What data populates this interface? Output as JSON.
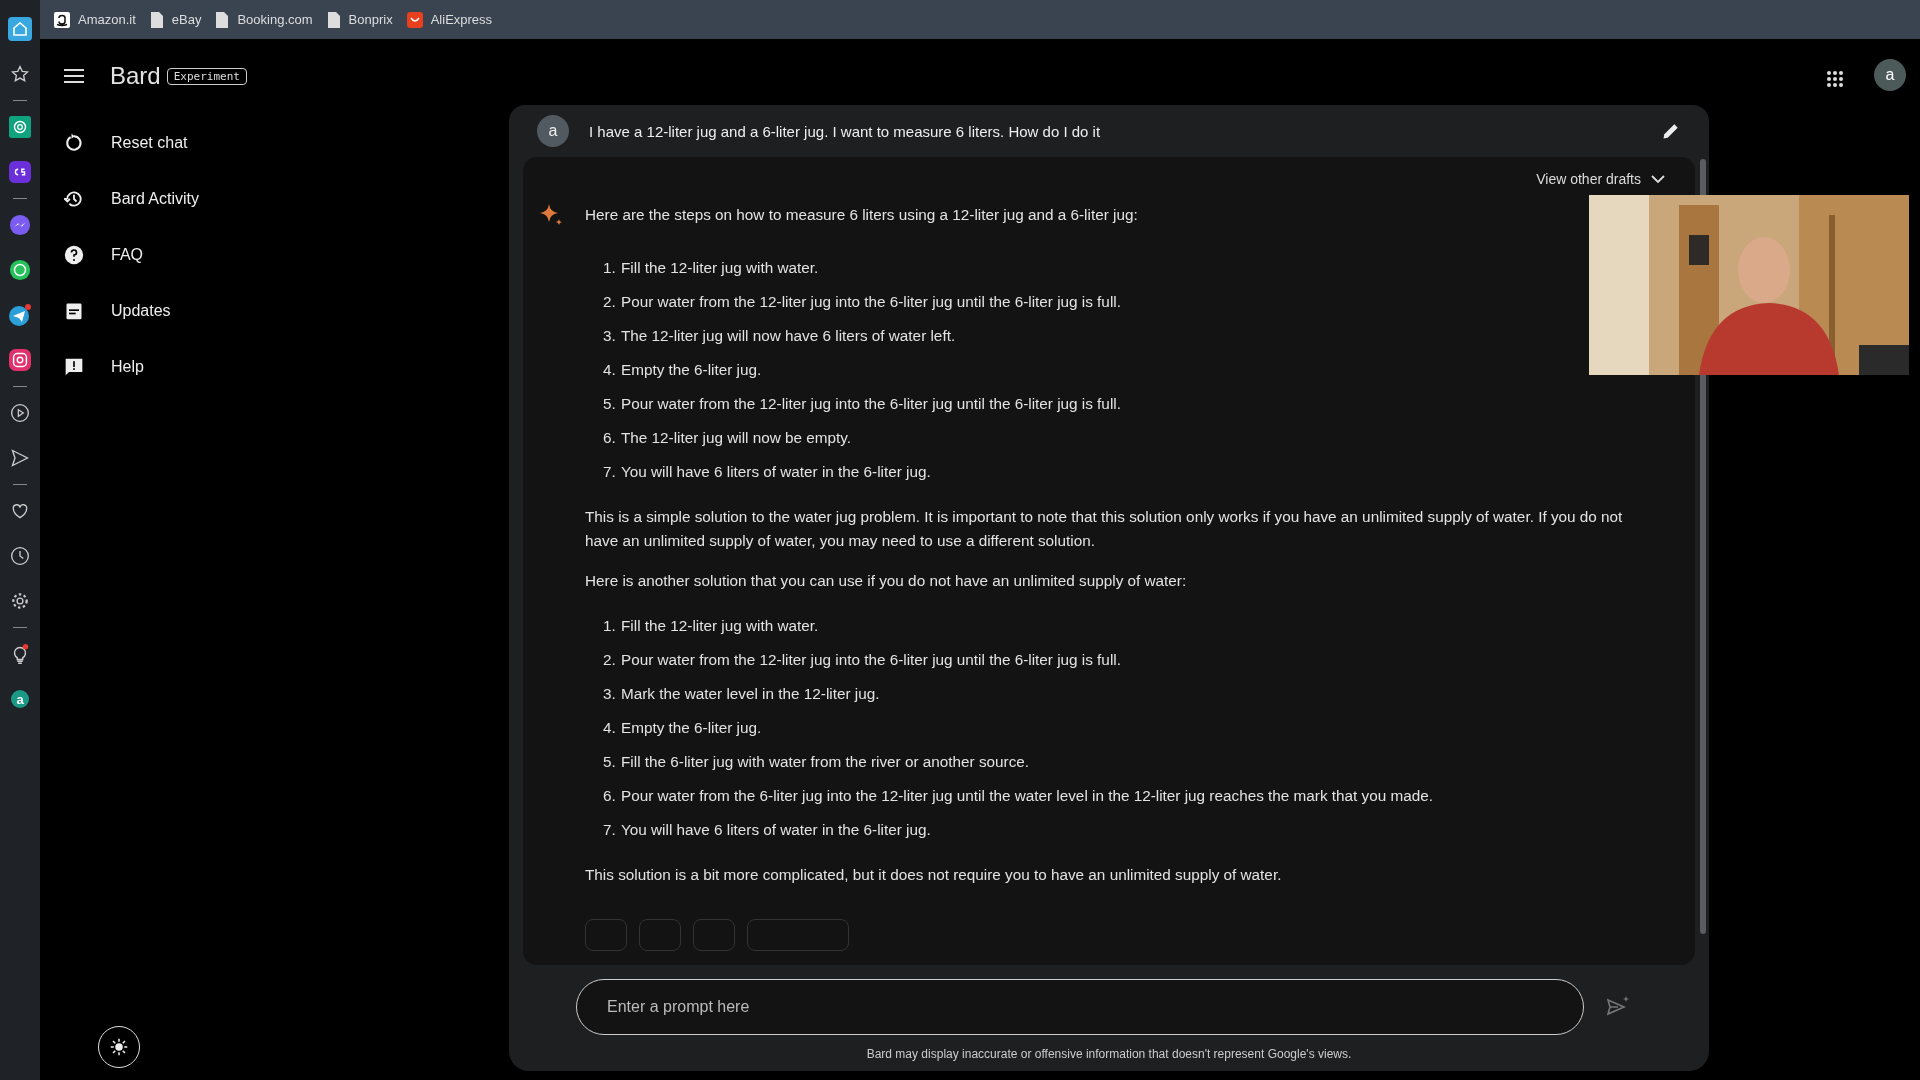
{
  "bookmarks": [
    {
      "label": "Amazon.it",
      "kind": "amazon"
    },
    {
      "label": "eBay",
      "kind": "page"
    },
    {
      "label": "Booking.com",
      "kind": "page"
    },
    {
      "label": "Bonprix",
      "kind": "page"
    },
    {
      "label": "AliExpress",
      "kind": "ali"
    }
  ],
  "header": {
    "title": "Bard",
    "badge": "Experiment",
    "avatar": "a"
  },
  "sidebar": {
    "items": [
      {
        "label": "Reset chat",
        "kind": "reset"
      },
      {
        "label": "Bard Activity",
        "kind": "history"
      },
      {
        "label": "FAQ",
        "kind": "faq"
      },
      {
        "label": "Updates",
        "kind": "updates"
      },
      {
        "label": "Help",
        "kind": "help"
      }
    ]
  },
  "dock": {
    "user_badge": "a"
  },
  "chat": {
    "prompt": {
      "avatar": "a",
      "text": "I have a 12-liter jug and a 6-liter jug. I want to measure 6 liters. How do I do it"
    },
    "drafts_label": "View other drafts",
    "response": [
      {
        "kind": "paragraph",
        "text": "Here are the steps on how to measure 6 liters using a 12-liter jug and a 6-liter jug:"
      },
      {
        "kind": "list",
        "items": [
          {
            "number": "1.",
            "text": "Fill the 12-liter jug with water."
          },
          {
            "number": "2.",
            "text": "Pour water from the 12-liter jug into the 6-liter jug until the 6-liter jug is full."
          },
          {
            "number": "3.",
            "text": "The 12-liter jug will now have 6 liters of water left."
          },
          {
            "number": "4.",
            "text": "Empty the 6-liter jug."
          },
          {
            "number": "5.",
            "text": "Pour water from the 12-liter jug into the 6-liter jug until the 6-liter jug is full."
          },
          {
            "number": "6.",
            "text": "The 12-liter jug will now be empty."
          },
          {
            "number": "7.",
            "text": "You will have 6 liters of water in the 6-liter jug."
          }
        ]
      },
      {
        "kind": "paragraph",
        "text": "This is a simple solution to the water jug problem. It is important to note that this solution only works if you have an unlimited supply of water. If you do not have an unlimited supply of water, you may need to use a different solution."
      },
      {
        "kind": "paragraph",
        "text": "Here is another solution that you can use if you do not have an unlimited supply of water:"
      },
      {
        "kind": "list",
        "items": [
          {
            "number": "1.",
            "text": "Fill the 12-liter jug with water."
          },
          {
            "number": "2.",
            "text": "Pour water from the 12-liter jug into the 6-liter jug until the 6-liter jug is full."
          },
          {
            "number": "3.",
            "text": "Mark the water level in the 12-liter jug."
          },
          {
            "number": "4.",
            "text": "Empty the 6-liter jug."
          },
          {
            "number": "5.",
            "text": "Fill the 6-liter jug with water from the river or another source."
          },
          {
            "number": "6.",
            "text": "Pour water from the 6-liter jug into the 12-liter jug until the water level in the 12-liter jug reaches the mark that you made."
          },
          {
            "number": "7.",
            "text": "You will have 6 liters of water in the 6-liter jug."
          }
        ]
      },
      {
        "kind": "paragraph",
        "text": "This solution is a bit more complicated, but it does not require you to have an unlimited supply of water."
      }
    ],
    "input": {
      "placeholder": "Enter a prompt here"
    },
    "disclaimer": "Bard may display inaccurate or offensive information that doesn't represent Google's views."
  }
}
